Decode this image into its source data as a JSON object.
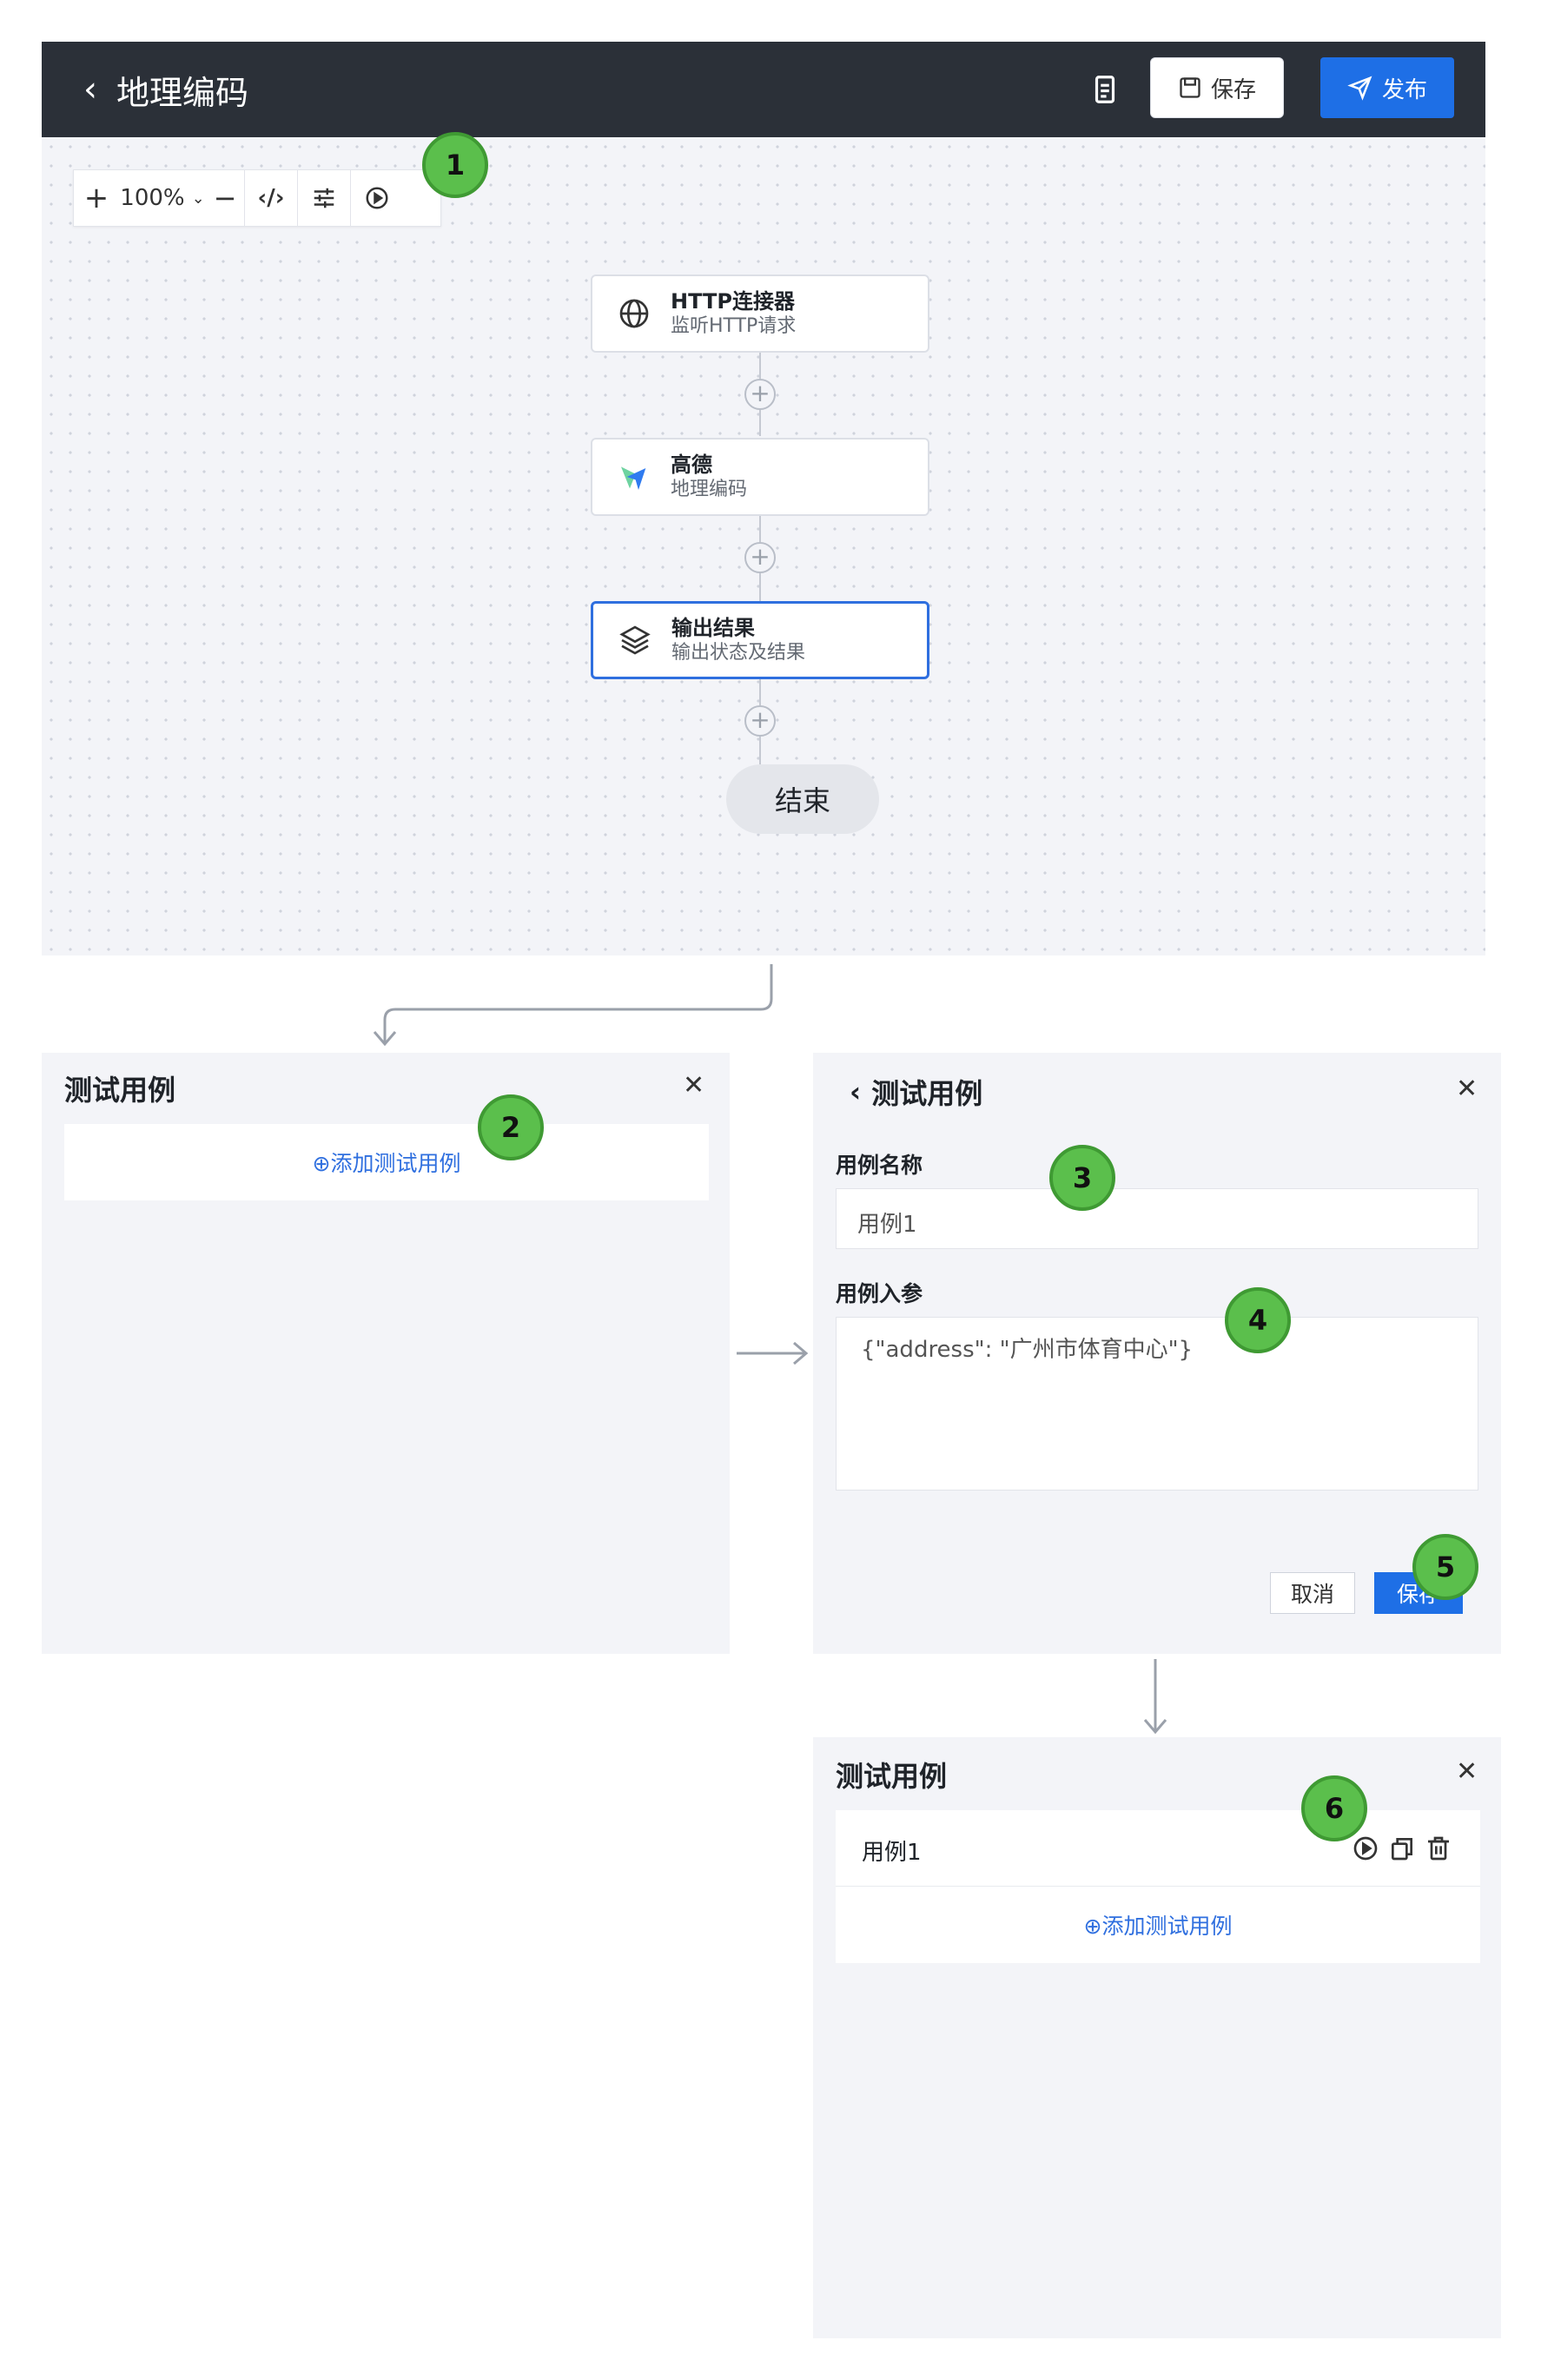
{
  "editor": {
    "title": "地理编码",
    "save_label": "保存",
    "publish_label": "发布",
    "zoom": "100%"
  },
  "nodes": [
    {
      "title": "HTTP连接器",
      "subtitle": "监听HTTP请求",
      "icon": "globe-icon"
    },
    {
      "title": "高德",
      "subtitle": "地理编码",
      "icon": "amap-logo-icon"
    },
    {
      "title": "输出结果",
      "subtitle": "输出状态及结果",
      "icon": "layers-icon"
    }
  ],
  "end_label": "结束",
  "badges": [
    "1",
    "2",
    "3",
    "4",
    "5",
    "6"
  ],
  "panel_empty": {
    "title": "测试用例",
    "add_label": "⊕添加测试用例"
  },
  "panel_form": {
    "title": "测试用例",
    "name_label": "用例名称",
    "name_value": "用例1",
    "params_label": "用例入参",
    "params_value": "{\"address\": \"广州市体育中心\"}",
    "cancel_label": "取消",
    "save_label": "保存"
  },
  "panel_list": {
    "title": "测试用例",
    "items": [
      {
        "name": "用例1"
      }
    ],
    "add_label": "⊕添加测试用例"
  },
  "colors": {
    "topbar": "#2b3038",
    "primary": "#1e6fe6",
    "canvas": "#f3f4f8",
    "badge": "#5bbf4c"
  }
}
